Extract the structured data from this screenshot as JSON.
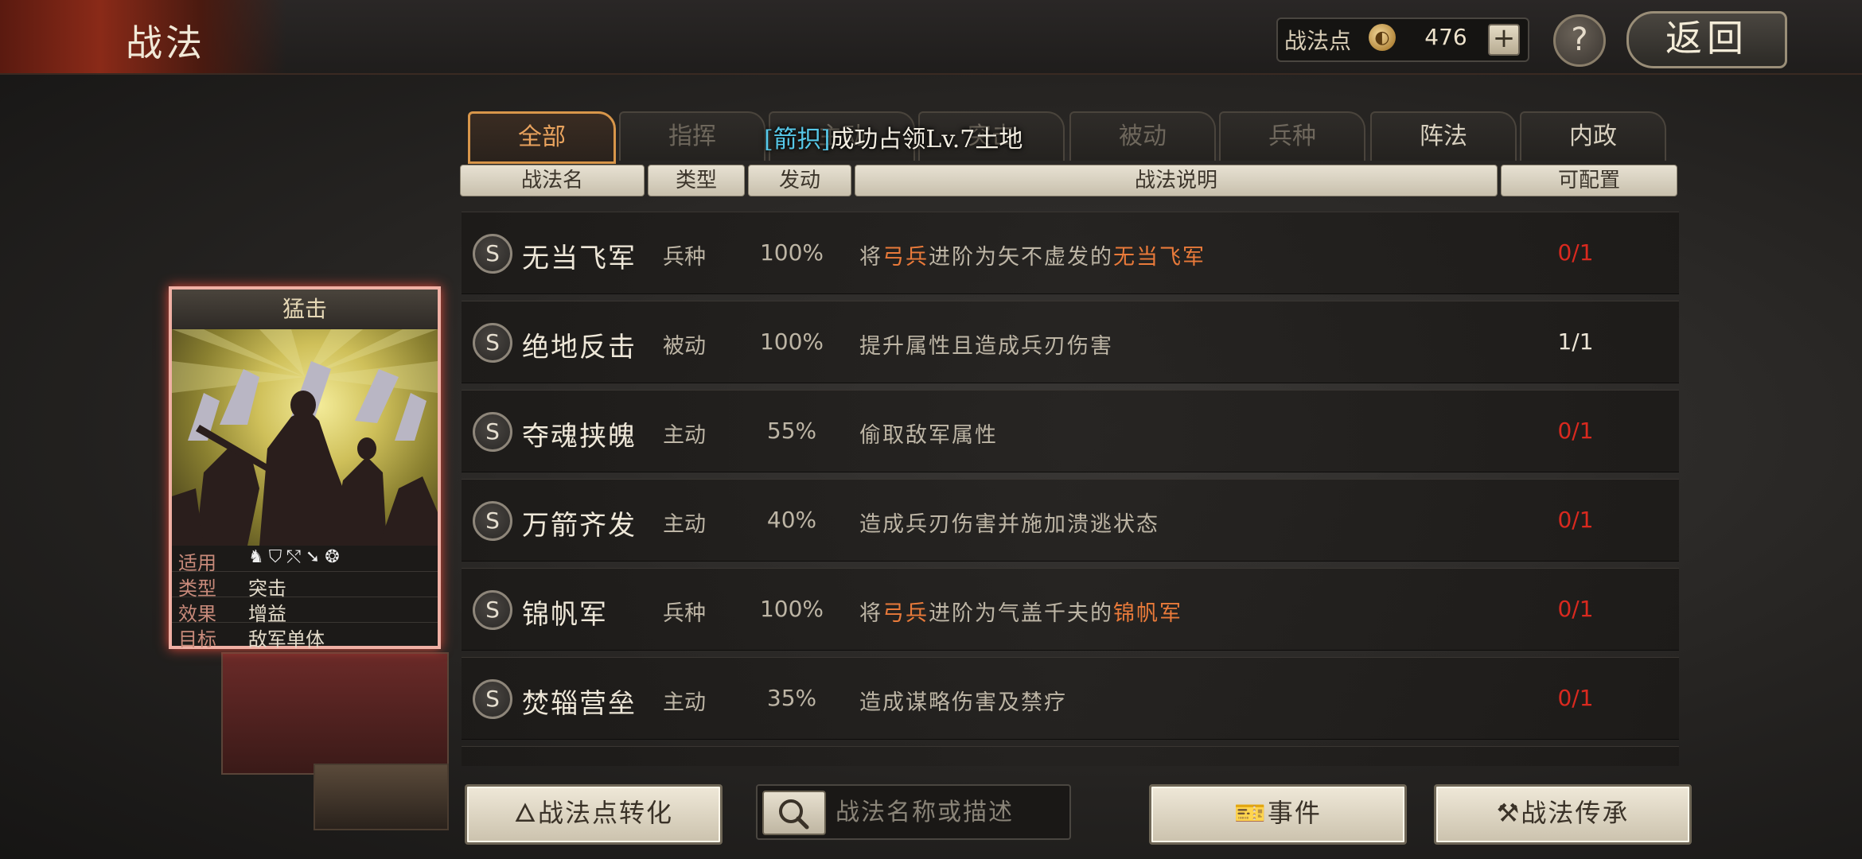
{
  "header": {
    "title": "战法",
    "points_label": "战法点",
    "points_value": "476",
    "plus_label": "+",
    "help_label": "?",
    "back_label": "返回"
  },
  "tabs": [
    {
      "label": "全部",
      "state": "active"
    },
    {
      "label": "指挥",
      "state": "dim"
    },
    {
      "label": "主动",
      "state": "dim"
    },
    {
      "label": "突击",
      "state": "dim"
    },
    {
      "label": "被动",
      "state": "dim"
    },
    {
      "label": "兵种",
      "state": "dim"
    },
    {
      "label": "阵法",
      "state": "lit"
    },
    {
      "label": "内政",
      "state": "lit"
    }
  ],
  "toast": {
    "highlight": "[箭抧]",
    "text": "成功占领Lv.7土地"
  },
  "columns": {
    "name": "战法名",
    "type": "类型",
    "rate": "发动",
    "desc": "战法说明",
    "config": "可配置"
  },
  "skills": [
    {
      "grade": "S",
      "name": "无当飞军",
      "type": "兵种",
      "rate": "100%",
      "desc": [
        "将",
        "弓兵",
        "进阶为矢不虚发的",
        "无当飞军",
        ""
      ],
      "config": "0/1",
      "config_color": "red"
    },
    {
      "grade": "S",
      "name": "绝地反击",
      "type": "被动",
      "rate": "100%",
      "desc": [
        "提升属性且造成兵刃伤害",
        "",
        "",
        "",
        ""
      ],
      "config": "1/1",
      "config_color": "white"
    },
    {
      "grade": "S",
      "name": "夺魂挟魄",
      "type": "主动",
      "rate": "55%",
      "desc": [
        "偷取敌军属性",
        "",
        "",
        "",
        ""
      ],
      "config": "0/1",
      "config_color": "red"
    },
    {
      "grade": "S",
      "name": "万箭齐发",
      "type": "主动",
      "rate": "40%",
      "desc": [
        "造成兵刃伤害并施加溃逃状态",
        "",
        "",
        "",
        ""
      ],
      "config": "0/1",
      "config_color": "red"
    },
    {
      "grade": "S",
      "name": "锦帆军",
      "type": "兵种",
      "rate": "100%",
      "desc": [
        "将",
        "弓兵",
        "进阶为气盖千夫的",
        "锦帆军",
        ""
      ],
      "config": "0/1",
      "config_color": "red"
    },
    {
      "grade": "S",
      "name": "焚辎营垒",
      "type": "主动",
      "rate": "35%",
      "desc": [
        "造成谋略伤害及禁疗",
        "",
        "",
        "",
        ""
      ],
      "config": "0/1",
      "config_color": "red"
    }
  ],
  "card": {
    "title": "猛击",
    "applicable_label": "适用",
    "applicable_icons": [
      "cavalry-icon",
      "shield-icon",
      "bow-icon",
      "spear-icon",
      "wheel-icon"
    ],
    "type_label": "类型",
    "type_value": "突击",
    "effect_label": "效果",
    "effect_value": "增益",
    "target_label": "目标",
    "target_value": "敌军单体"
  },
  "bottom": {
    "convert_label": "战法点转化",
    "search_placeholder": "战法名称或描述",
    "event_label": "事件",
    "inherit_label": "战法传承"
  },
  "colors": {
    "accent_orange": "#e97a3a",
    "config_red": "#d9291f",
    "tab_active": "#e9a35e",
    "toast_highlight": "#57c8e8"
  }
}
